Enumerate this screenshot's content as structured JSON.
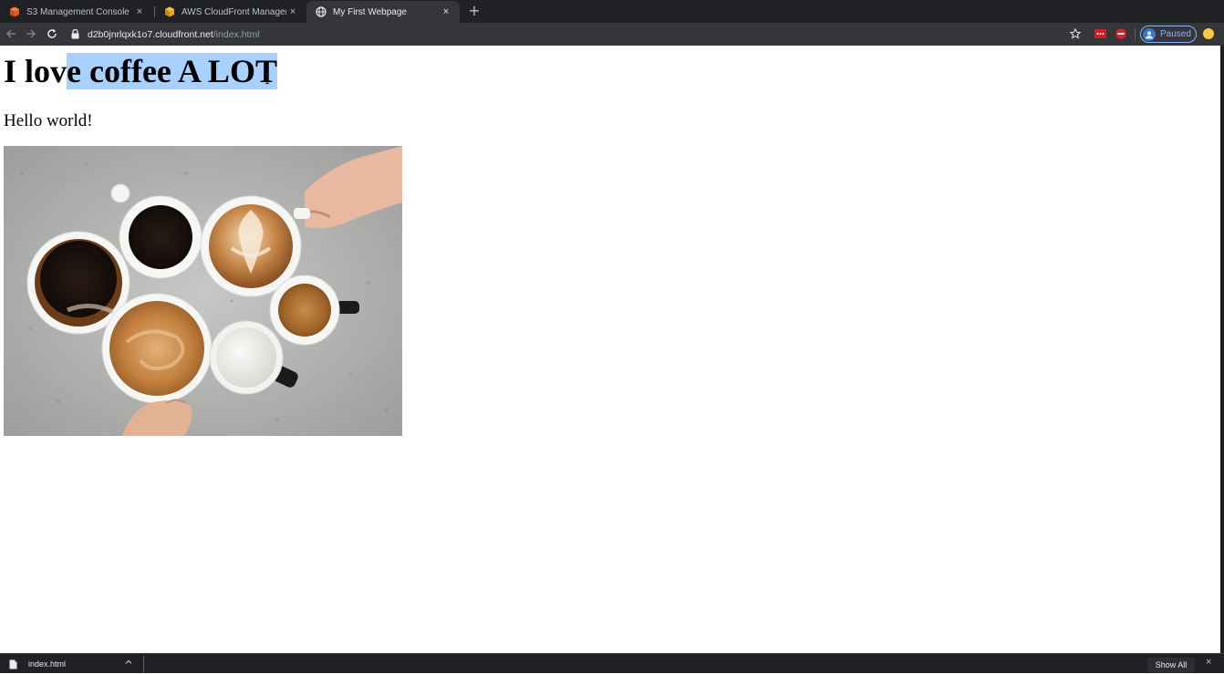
{
  "tabs": [
    {
      "title": "S3 Management Console",
      "favicon": "aws-s3-icon",
      "active": false
    },
    {
      "title": "AWS CloudFront Management",
      "favicon": "aws-cloudfront-icon",
      "active": false
    },
    {
      "title": "My First Webpage",
      "favicon": "globe-icon",
      "active": true
    }
  ],
  "tab_close_glyph": "×",
  "new_tab_glyph": "+",
  "address": {
    "host": "d2b0jnrlqxk1o7.cloudfront.net",
    "path": "/index.html"
  },
  "profile": {
    "label": "Paused"
  },
  "extensions": [
    "lastpass-icon",
    "adblock-icon"
  ],
  "page": {
    "heading_before": "I lov",
    "heading_selected": "e coffee A LOT",
    "paragraph": "Hello world!",
    "image_alt": "Cups of coffee on a concrete table"
  },
  "downloads": {
    "file_name": "index.html",
    "show_all_label": "Show All",
    "close_glyph": "×"
  },
  "colors": {
    "selection": "#a8d1ff",
    "tabstrip": "#202124",
    "toolbar": "#35363a",
    "accent": "#8ab4f8"
  }
}
